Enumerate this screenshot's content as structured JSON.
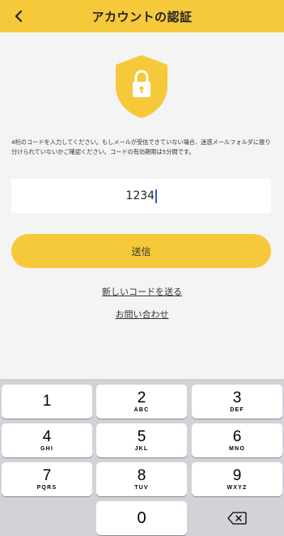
{
  "header": {
    "title": "アカウントの認証",
    "back_icon": "chevron-left-icon"
  },
  "shield": {
    "icon": "shield-lock-icon",
    "color": "#f6c93a"
  },
  "description": "4桁のコードを入力してください。もしメールが受信できていない場合、迷惑メールフォルダに振り分けられていないかご確認ください。コードの有効期限は5分間です。",
  "code_input": {
    "value": "1234"
  },
  "submit_label": "送信",
  "resend_link": "新しいコードを送る",
  "contact_link": "お問い合わせ",
  "keyboard": {
    "keys": [
      {
        "num": "1",
        "letters": ""
      },
      {
        "num": "2",
        "letters": "ABC"
      },
      {
        "num": "3",
        "letters": "DEF"
      },
      {
        "num": "4",
        "letters": "GHI"
      },
      {
        "num": "5",
        "letters": "JKL"
      },
      {
        "num": "6",
        "letters": "MNO"
      },
      {
        "num": "7",
        "letters": "PQRS"
      },
      {
        "num": "8",
        "letters": "TUV"
      },
      {
        "num": "9",
        "letters": "WXYZ"
      },
      {
        "num": "0",
        "letters": ""
      }
    ],
    "delete_icon": "backspace-icon"
  },
  "colors": {
    "accent": "#f6c93a",
    "background": "#f4f4f4",
    "keyboard_bg": "#d1d3d9"
  }
}
